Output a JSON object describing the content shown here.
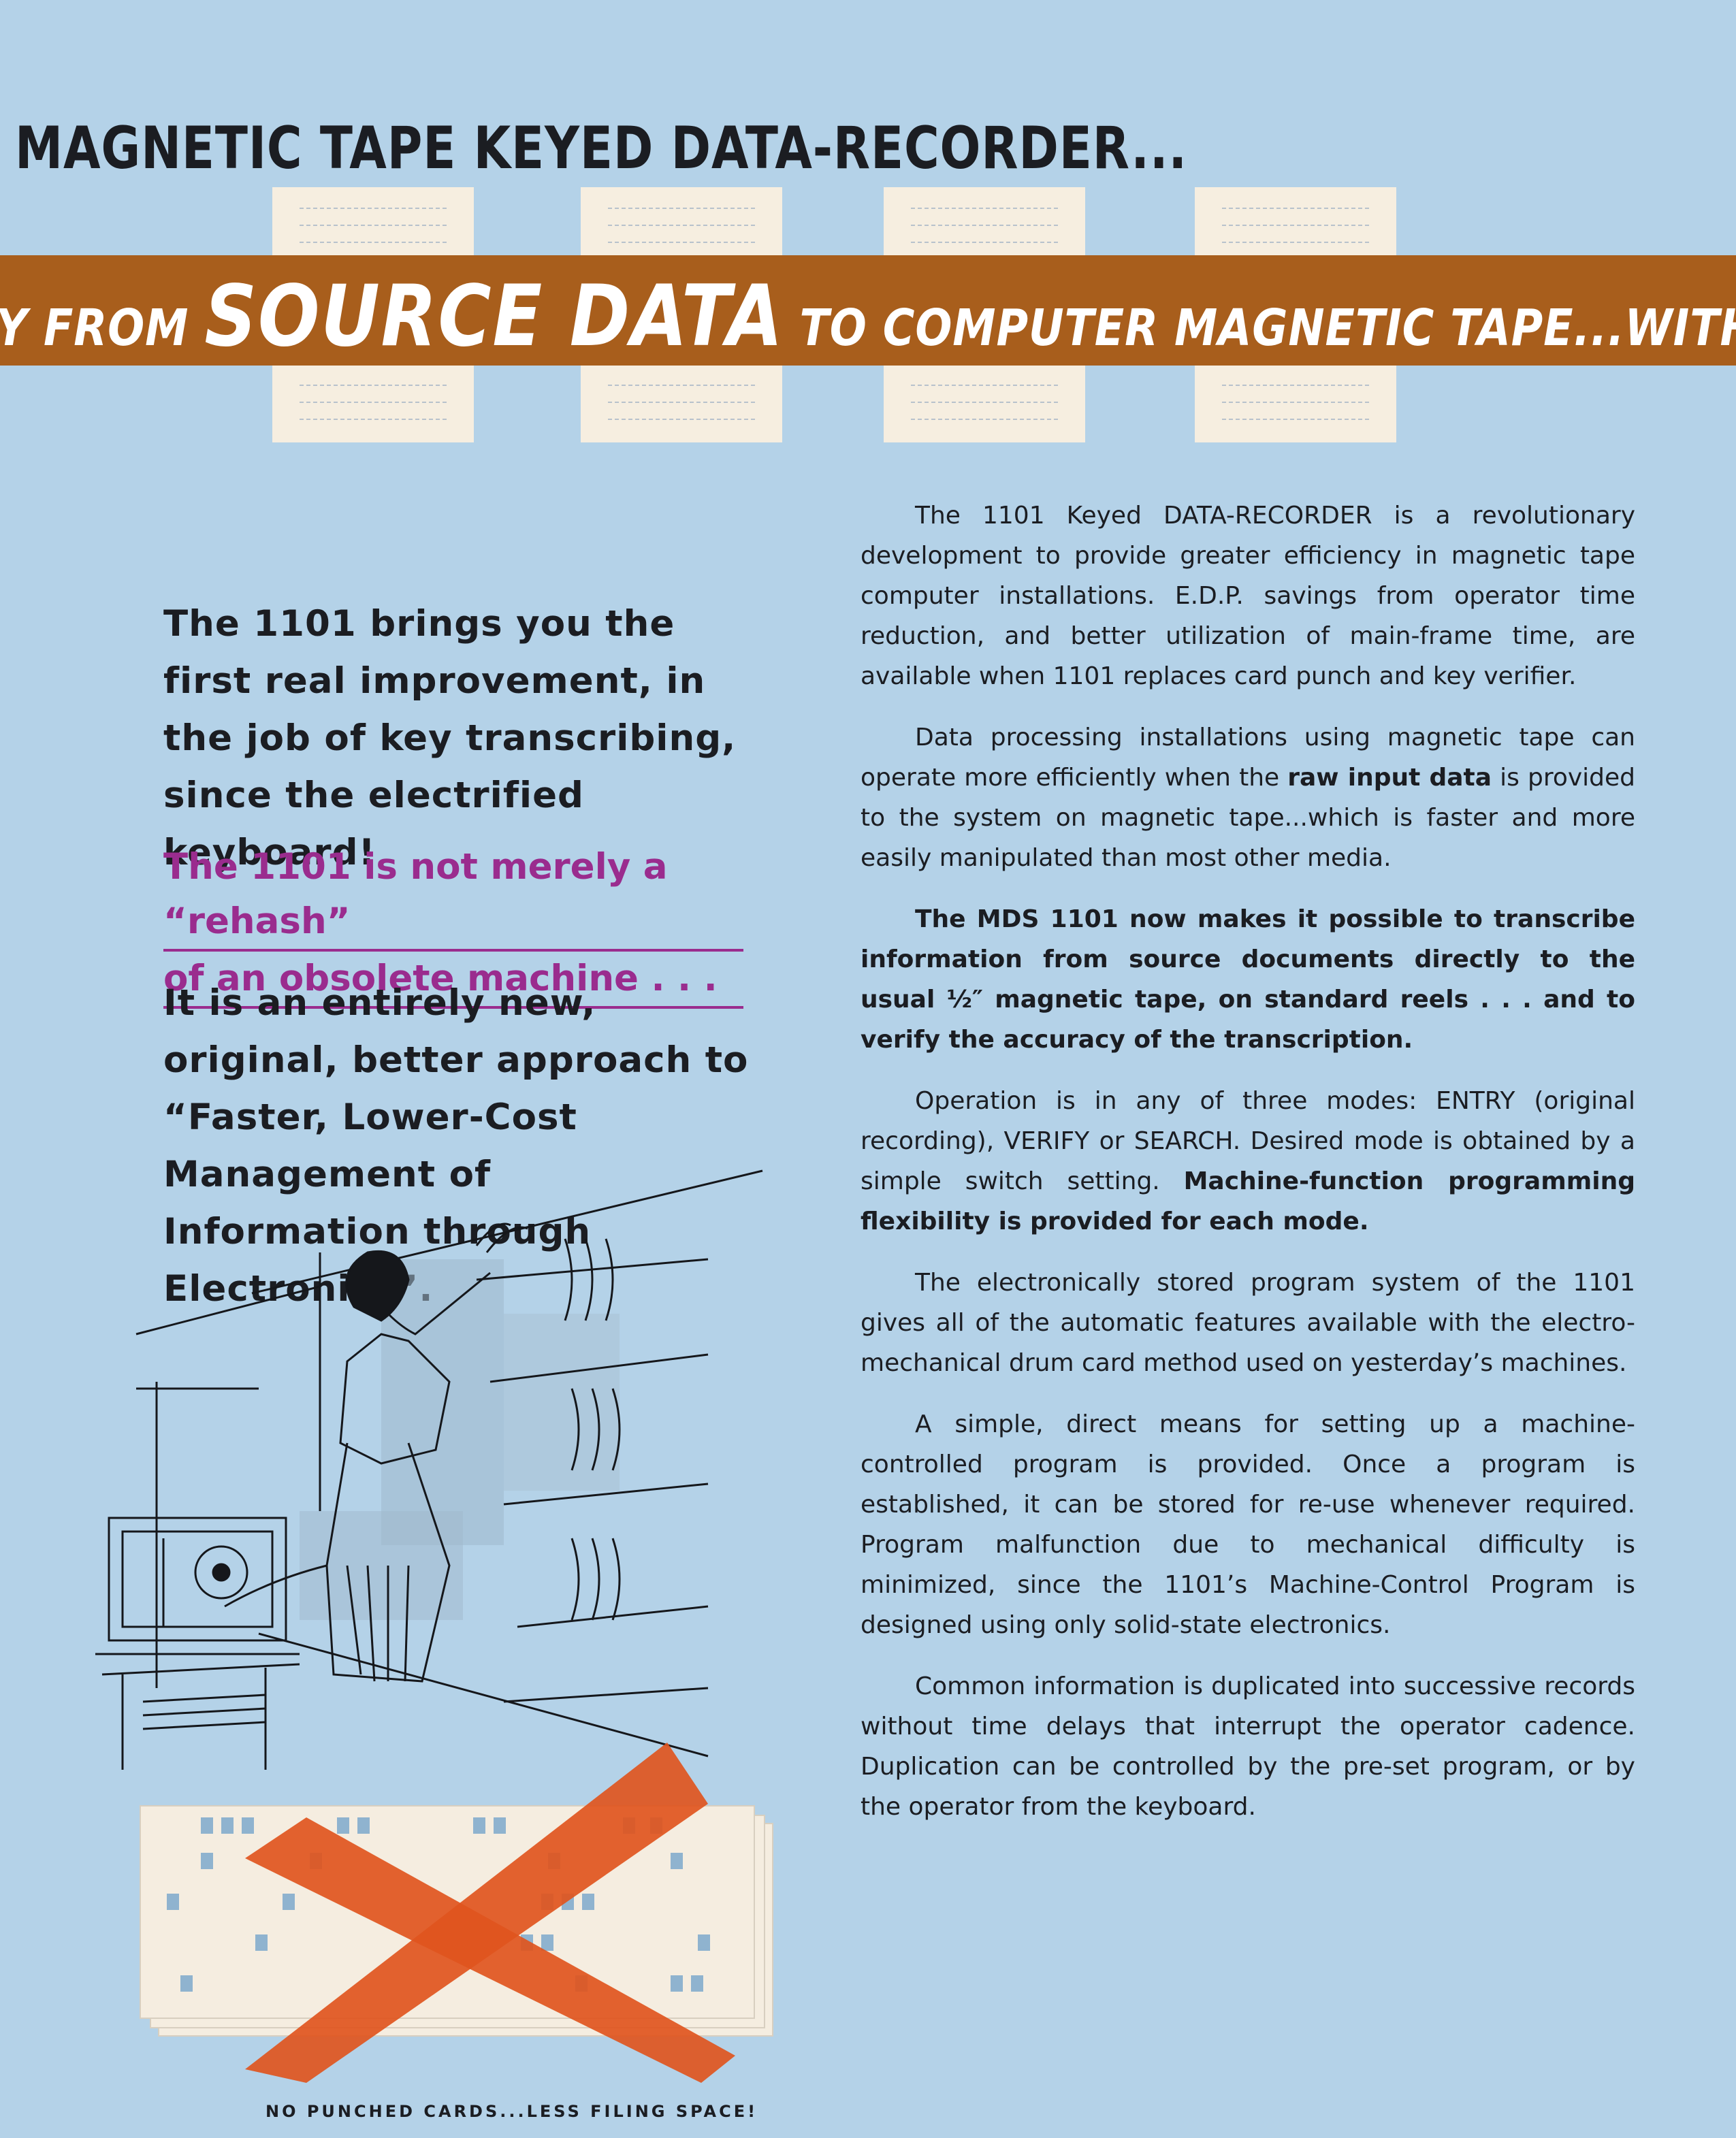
{
  "title": "MAGNETIC TAPE KEYED DATA-RECORDER...",
  "banner": {
    "part1": "Y FROM ",
    "part2": "SOURCE DATA",
    "part3": " TO COMPUTER MAGNETIC TAPE...WITH NO I"
  },
  "lead": "The 1101 brings you the first real improvement, in the job of key transcribing, since the electrified keyboard!",
  "callout": {
    "line1": "The 1101 is not merely a “rehash”",
    "line2": "of an obsolete machine . . ."
  },
  "lead2": "It is an entirely new, original, better approach to “Faster, Lower-Cost Management of Information through Electronics”.",
  "paragraphs": {
    "p1": "The 1101 Keyed DATA-RECORDER is a revolutionary development to provide greater efficiency in magnetic tape computer installations. E.D.P. savings from operator time reduction, and better utilization of main-frame time, are available when 1101 replaces card punch and key verifier.",
    "p2a": "Data processing installations using magnetic tape can operate more efficiently when the ",
    "p2b": "raw input data",
    "p2c": " is provided to the system on magnetic tape...which is faster and more easily manipulated than most other media.",
    "p3": "The MDS 1101 now makes it possible to transcribe information from source documents directly to the usual ½″ magnetic tape, on standard reels . . . and to verify the accuracy of the transcription.",
    "p4a": "Operation is in any of three modes: ENTRY (original recording), VERIFY or SEARCH. Desired mode is obtained by a simple switch setting. ",
    "p4b": "Machine-function programming flexibility is provided for each mode.",
    "p5": "The electronically stored program system of the 1101 gives all of the automatic features available with the electro-mechanical drum card method used on yesterday’s machines.",
    "p6": "A simple, direct means for setting up a machine-controlled program is provided. Once a program is established, it can be stored for re-use whenever required. Program malfunction due to mechanical difficulty is minimized, since the 1101’s Machine-Control Program is designed using only solid-state electronics.",
    "p7": "Common information is duplicated into successive records without time delays that interrupt the operator cadence. Duplication can be controlled by the pre-set program, or by the operator from the keyboard."
  },
  "caption": "NO PUNCHED CARDS...LESS FILING SPACE!",
  "colors": {
    "background": "#b4d2e8",
    "banner": "#a85e1c",
    "callout": "#9a2c8e",
    "x_mark": "#e0551e"
  }
}
